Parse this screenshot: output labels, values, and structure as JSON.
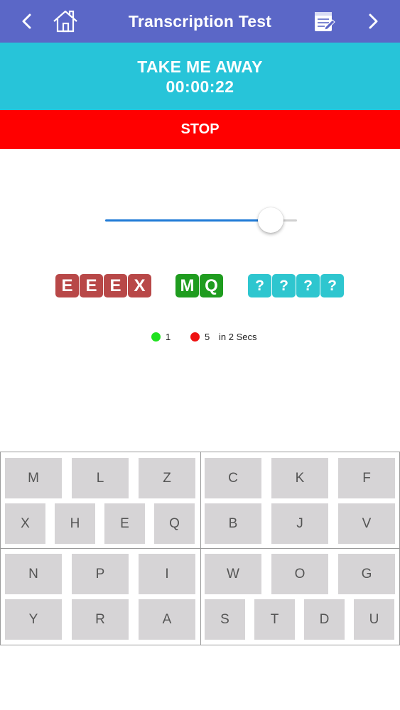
{
  "navbar": {
    "title": "Transcription Test",
    "back_icon": "chevron-left-icon",
    "home_icon": "home-icon",
    "edit_icon": "notepad-edit-icon",
    "forward_icon": "chevron-right-icon",
    "color": "#5b67c7"
  },
  "song": {
    "title": "TAKE ME AWAY",
    "time": "00:00:22",
    "color": "#27c4d9"
  },
  "stop": {
    "label": "STOP",
    "color": "#ff0000"
  },
  "slider": {
    "value": 0.92,
    "fill_color": "#1f7ad6"
  },
  "tiles": {
    "incorrect": [
      "E",
      "E",
      "E",
      "X"
    ],
    "correct": [
      "M",
      "Q"
    ],
    "remaining": [
      "?",
      "?",
      "?",
      "?"
    ],
    "colors": {
      "incorrect": "#b84848",
      "correct": "#1f9c1f",
      "remaining": "#2ec6cf"
    }
  },
  "score": {
    "correct_count": "1",
    "wrong_count": "5",
    "time_text": "in 2 Secs"
  },
  "keyboard": {
    "quadrants": [
      {
        "rows": [
          [
            "M",
            "L",
            "Z"
          ],
          [
            "X",
            "H",
            "E",
            "Q"
          ]
        ]
      },
      {
        "rows": [
          [
            "C",
            "K",
            "F"
          ],
          [
            "B",
            "J",
            "V"
          ]
        ]
      },
      {
        "rows": [
          [
            "N",
            "P",
            "I"
          ],
          [
            "Y",
            "R",
            "A"
          ]
        ]
      },
      {
        "rows": [
          [
            "W",
            "O",
            "G"
          ],
          [
            "S",
            "T",
            "D",
            "U"
          ]
        ]
      }
    ]
  }
}
